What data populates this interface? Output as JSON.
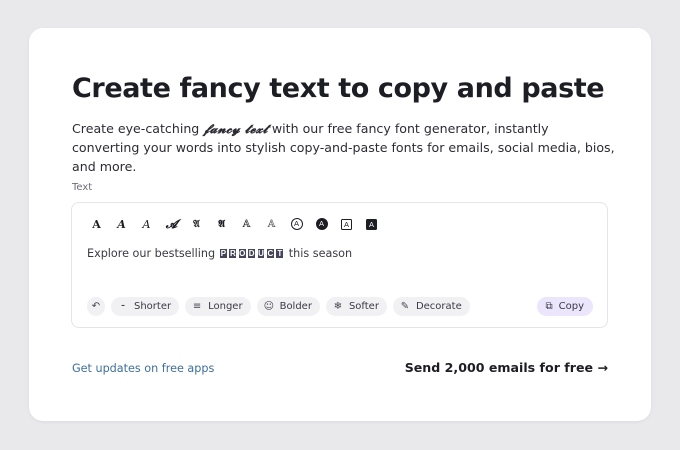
{
  "header": {
    "title": "Create fancy text to copy and paste",
    "description_before": "Create eye-catching ",
    "description_fancy": "𝓯𝓪𝓷𝓬𝔂 𝓽𝓮𝔁𝓽",
    "description_after": " with our free fancy font generator, instantly converting your words into stylish copy-and-paste fonts for emails, social media, bios, and more."
  },
  "field": {
    "label": "Text"
  },
  "font_styles": [
    {
      "glyph": "A",
      "icon": "serif-bold-a"
    },
    {
      "glyph": "A",
      "icon": "serif-bold-italic-a"
    },
    {
      "glyph": "A",
      "icon": "serif-italic-a"
    },
    {
      "glyph": "𝓐",
      "icon": "script-a"
    },
    {
      "glyph": "𝔄",
      "icon": "fraktur-a"
    },
    {
      "glyph": "𝕬",
      "icon": "fraktur-bold-a"
    },
    {
      "glyph": "𝔸",
      "icon": "double-struck-a"
    },
    {
      "glyph": "𝔸",
      "icon": "outline-a"
    },
    {
      "glyph": "A",
      "icon": "circled-a"
    },
    {
      "glyph": "A",
      "icon": "negative-circled-a"
    },
    {
      "glyph": "A",
      "icon": "squared-a"
    },
    {
      "glyph": "A",
      "icon": "negative-squared-a"
    }
  ],
  "editor": {
    "text_before": "Explore our bestselling",
    "boxed_word": [
      "P",
      "R",
      "O",
      "D",
      "U",
      "C",
      "T"
    ],
    "text_after": "this season"
  },
  "actions": {
    "undo_icon": "undo-icon",
    "shorter": "Shorter",
    "longer": "Longer",
    "bolder": "Bolder",
    "softer": "Softer",
    "decorate": "Decorate",
    "copy": "Copy"
  },
  "footer": {
    "updates_link": "Get updates on free apps",
    "cta": "Send 2,000 emails for free →"
  },
  "colors": {
    "background": "#e9e9ec",
    "card": "#ffffff",
    "link": "#3f6f9e",
    "copy_chip": "#ebe6fb",
    "chip": "#f1f1f4"
  }
}
